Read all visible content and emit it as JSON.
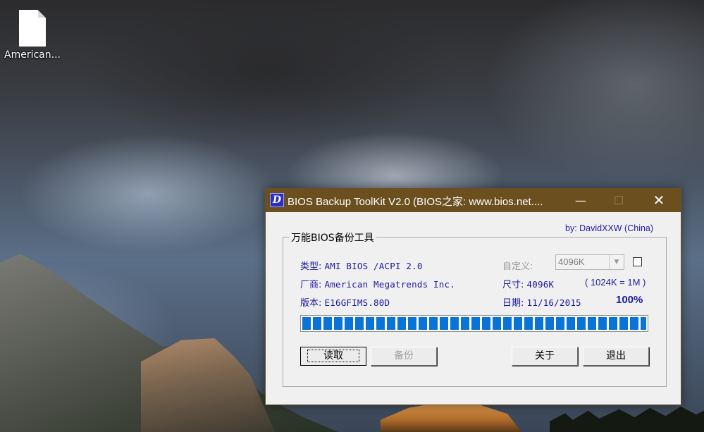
{
  "desktop": {
    "icon_label": "American..."
  },
  "window": {
    "title": "BIOS Backup ToolKit V2.0 (BIOS之家: www.bios.net....",
    "app_icon_glyph": "D",
    "minimize_glyph": "—",
    "maximize_glyph": "☐",
    "close_glyph": "✕",
    "byline": "by: DavidXXW   (China)",
    "group_title": "万能BIOS备份工具",
    "type_label": "类型:",
    "type_value": "AMI BIOS  /ACPI 2.0",
    "vendor_label": "厂商:",
    "vendor_value": "American Megatrends Inc.",
    "version_label": "版本:",
    "version_value": "E16GFIMS.80D",
    "custom_label": "自定义:",
    "custom_select_value": "4096K",
    "custom_checked": false,
    "size_label": "尺寸:",
    "size_value": "4096K",
    "size_hint": "( 1024K = 1M )",
    "date_label": "日期:",
    "date_value": "11/16/2015",
    "progress_text": "100%",
    "progress_fraction": 1.0,
    "buttons": {
      "read": "读取",
      "backup": "备份",
      "about": "关于",
      "exit": "退出"
    }
  },
  "colors": {
    "titlebar": "#6b4f1e",
    "label_text": "#1a1aa0",
    "progress": "#0a73d8"
  }
}
